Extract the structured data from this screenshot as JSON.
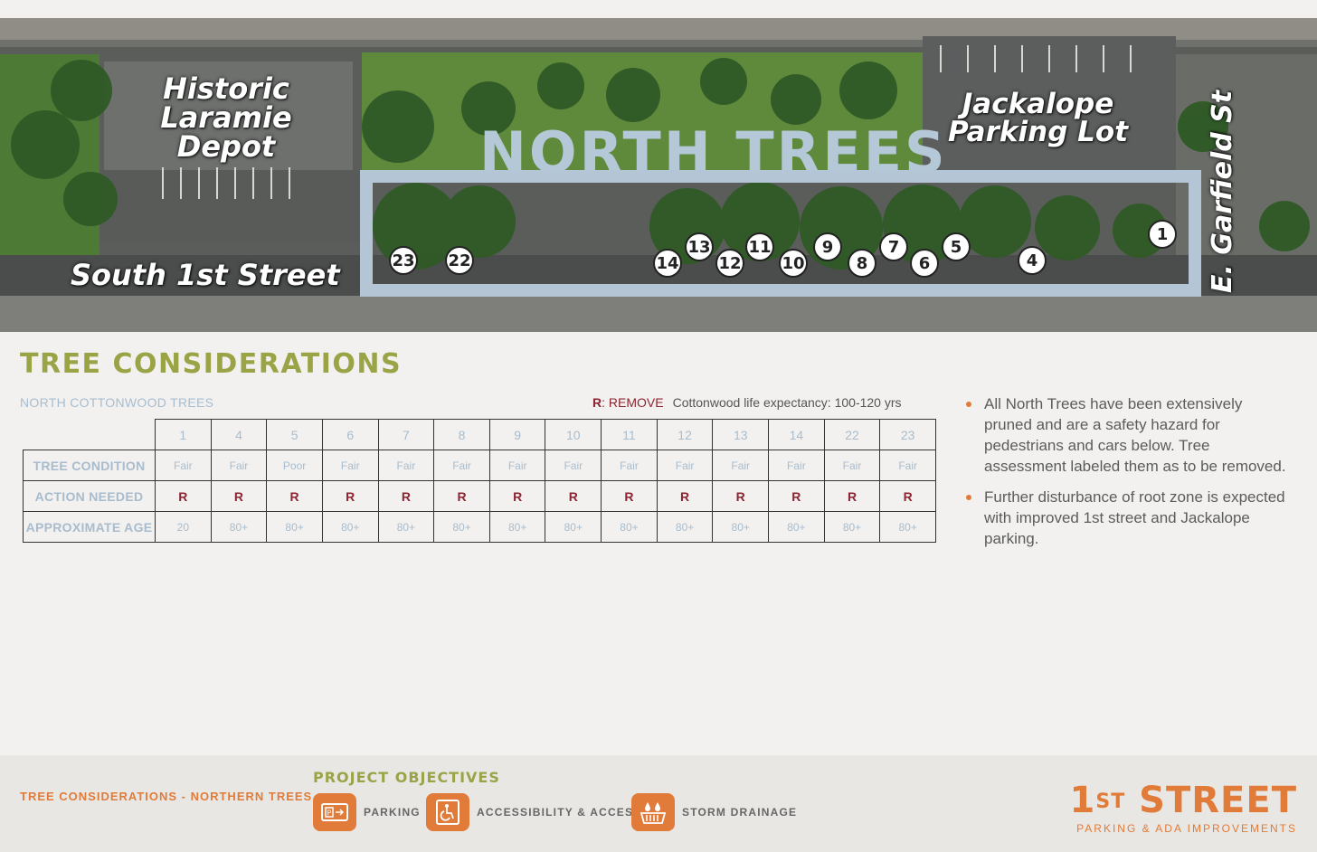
{
  "map": {
    "title": "NORTH TREES",
    "labels": {
      "depot": "Historic Laramie Depot",
      "south_street": "South 1st Street",
      "jackalope": "Jackalope Parking Lot",
      "garfield": "E. Garfield St"
    },
    "tree_markers": [
      "23",
      "22",
      "14",
      "13",
      "12",
      "11",
      "10",
      "9",
      "8",
      "7",
      "6",
      "5",
      "4",
      "1"
    ]
  },
  "section": {
    "title": "TREE CONSIDERATIONS",
    "subtitle": "NORTH COTTONWOOD TREES",
    "legend_r": "R",
    "legend_remove": ": REMOVE",
    "legend_expectancy": "Cottonwood life expectancy: 100-120 yrs"
  },
  "table": {
    "tree_numbers": [
      "1",
      "4",
      "5",
      "6",
      "7",
      "8",
      "9",
      "10",
      "11",
      "12",
      "13",
      "14",
      "22",
      "23"
    ],
    "rows": [
      {
        "label": "TREE CONDITION",
        "values": [
          "Fair",
          "Fair",
          "Poor",
          "Fair",
          "Fair",
          "Fair",
          "Fair",
          "Fair",
          "Fair",
          "Fair",
          "Fair",
          "Fair",
          "Fair",
          "Fair"
        ]
      },
      {
        "label": "ACTION NEEDED",
        "values": [
          "R",
          "R",
          "R",
          "R",
          "R",
          "R",
          "R",
          "R",
          "R",
          "R",
          "R",
          "R",
          "R",
          "R"
        ]
      },
      {
        "label": "APPROXIMATE AGE",
        "values": [
          "20",
          "80+",
          "80+",
          "80+",
          "80+",
          "80+",
          "80+",
          "80+",
          "80+",
          "80+",
          "80+",
          "80+",
          "80+",
          "80+"
        ]
      }
    ]
  },
  "notes": [
    "All North Trees have been extensively pruned and are a safety hazard for pedestrians and cars below. Tree assessment labeled them as to be removed.",
    "Further disturbance of root zone is expected with improved 1st street and Jackalope parking."
  ],
  "footer": {
    "page_label": "TREE CONSIDERATIONS - NORTHERN TREES",
    "objectives_title": "PROJECT OBJECTIVES",
    "objectives": [
      {
        "icon": "parking-icon",
        "label": "PARKING"
      },
      {
        "icon": "accessibility-icon",
        "label": "ACCESSIBILITY & ACCESS"
      },
      {
        "icon": "storm-drainage-icon",
        "label": "STORM DRAINAGE"
      }
    ],
    "brand_main": "1",
    "brand_sup": "ST",
    "brand_word": " STREET",
    "brand_sub": "PARKING & ADA IMPROVEMENTS"
  },
  "colors": {
    "accent_orange": "#e07b39",
    "olive": "#9aa447",
    "remove_red": "#8c2431",
    "light_blue": "#b4c6d6"
  }
}
